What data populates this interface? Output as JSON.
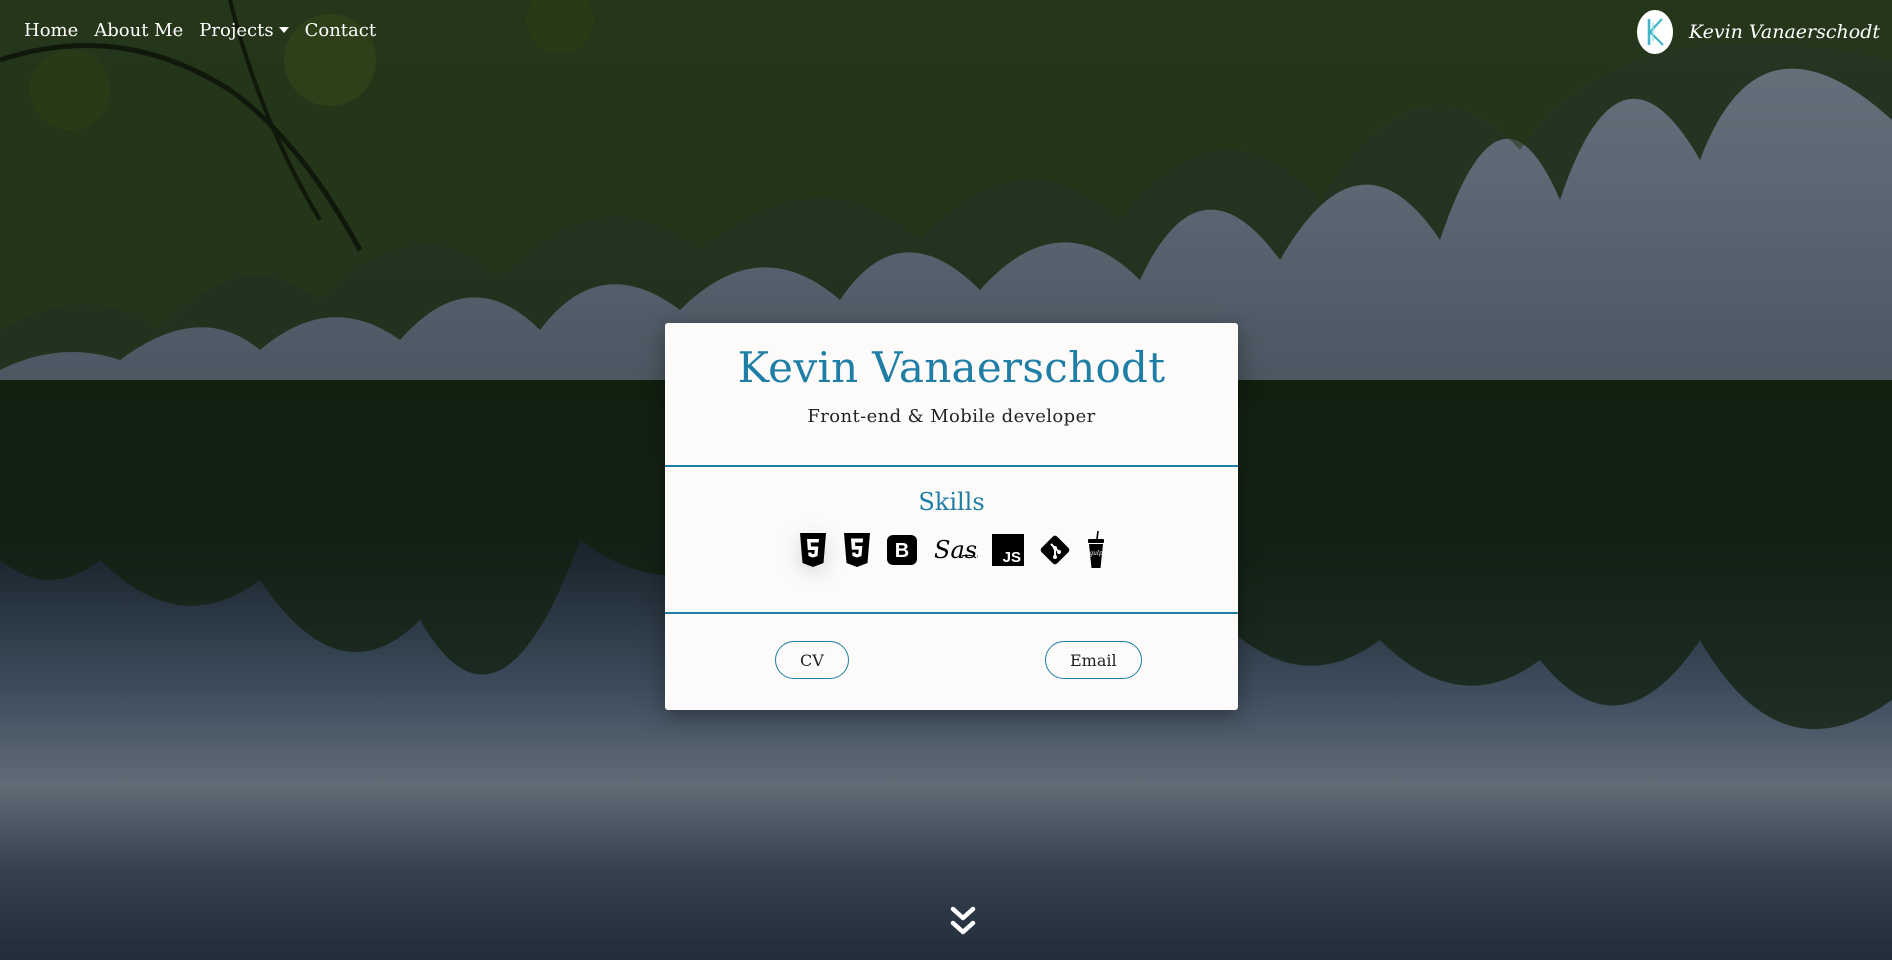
{
  "nav": {
    "links": [
      {
        "label": "Home"
      },
      {
        "label": "About Me"
      },
      {
        "label": "Projects",
        "has_dropdown": true
      },
      {
        "label": "Contact"
      }
    ],
    "brand": {
      "name": "Kevin Vanaerschodt",
      "logo_icon": "k-monogram-logo"
    }
  },
  "card": {
    "title": "Kevin Vanaerschodt",
    "subtitle": "Front-end & Mobile developer",
    "skills_title": "Skills",
    "skill_icons": [
      "html5-icon",
      "css3-icon",
      "bootstrap-icon",
      "sass-icon",
      "javascript-icon",
      "git-icon",
      "gulp-icon"
    ],
    "buttons": {
      "cv": "CV",
      "email": "Email"
    }
  },
  "scroll_icon": "double-chevron-down-icon",
  "colors": {
    "accent": "#1e7ea5",
    "card_bg": "#fcfbf9",
    "nav_text": "#ffffff"
  }
}
